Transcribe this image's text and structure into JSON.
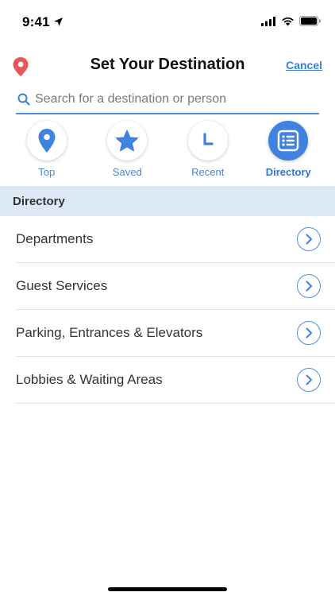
{
  "status_bar": {
    "time": "9:41"
  },
  "header": {
    "title": "Set Your Destination",
    "cancel_label": "Cancel"
  },
  "search": {
    "placeholder": "Search for a destination or person",
    "value": ""
  },
  "tabs": [
    {
      "label": "Top",
      "icon": "map-pin-icon",
      "active": false
    },
    {
      "label": "Saved",
      "icon": "star-icon",
      "active": false
    },
    {
      "label": "Recent",
      "icon": "clock-icon",
      "active": false
    },
    {
      "label": "Directory",
      "icon": "list-icon",
      "active": true
    }
  ],
  "section": {
    "title": "Directory"
  },
  "directory": {
    "items": [
      {
        "label": "Departments"
      },
      {
        "label": "Guest Services"
      },
      {
        "label": "Parking, Entrances & Elevators"
      },
      {
        "label": "Lobbies & Waiting Areas"
      }
    ]
  },
  "colors": {
    "accent": "#3f82e0",
    "section_bg": "#dce9f5",
    "pin": "#e8585a"
  }
}
